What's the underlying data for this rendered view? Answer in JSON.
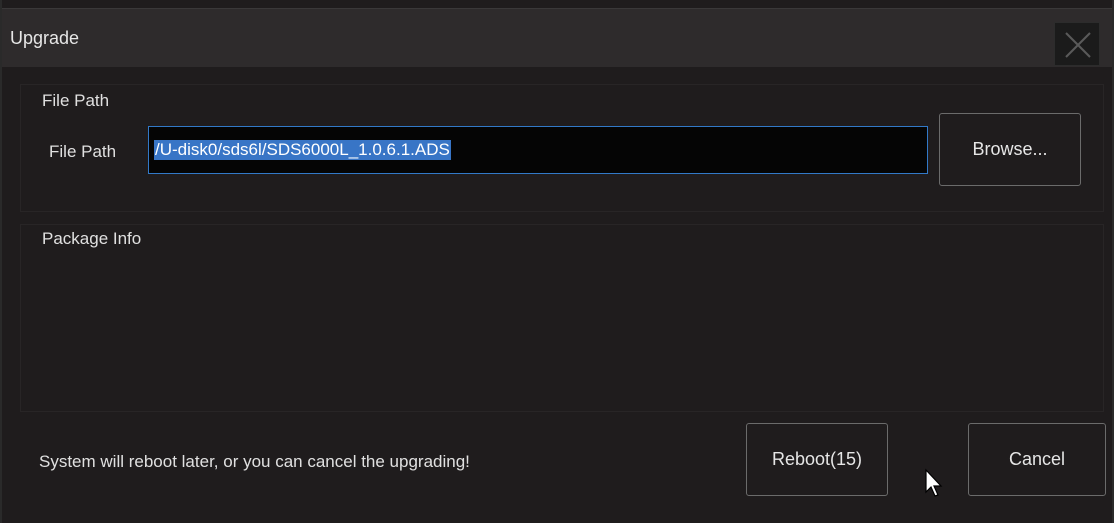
{
  "dialog": {
    "title": "Upgrade",
    "close_icon": "close-x-icon"
  },
  "file_group": {
    "label": "File Path",
    "field_label": "File Path",
    "path_value": "/U-disk0/sds6l/SDS6000L_1.0.6.1.ADS",
    "browse_label": "Browse..."
  },
  "package_group": {
    "label": "Package Info"
  },
  "footer": {
    "message": "System will reboot later, or you can cancel the upgrading!",
    "reboot_label": "Reboot(15)",
    "cancel_label": "Cancel"
  },
  "colors": {
    "background": "#1f1c1d",
    "titlebar": "#2e2b2c",
    "input_border": "#3279c8",
    "selection": "#3875c6",
    "button_border": "#6b6b6b"
  }
}
